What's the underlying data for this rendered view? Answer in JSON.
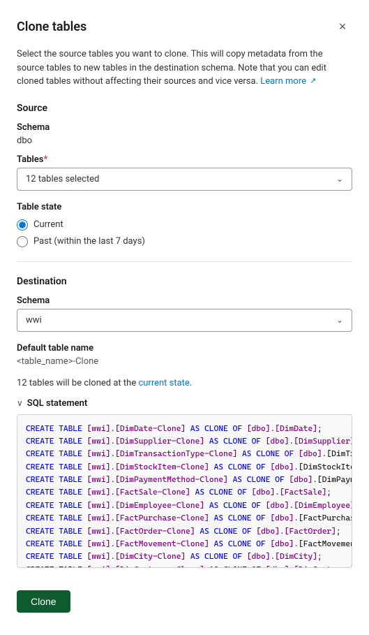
{
  "dialog": {
    "title": "Clone tables",
    "close_label": "×"
  },
  "description": {
    "text": "Select the source tables you want to clone. This will copy metadata from the source tables to new tables in the destination schema. Note that you can edit cloned tables without affecting their sources and vice versa.",
    "learn_more_label": "Learn more",
    "learn_more_icon": "↗"
  },
  "source": {
    "section_label": "Source",
    "schema_label": "Schema",
    "schema_value": "dbo",
    "tables_label": "Tables",
    "tables_required": "*",
    "tables_selected": "12 tables selected",
    "table_state_label": "Table state",
    "radio_current_label": "Current",
    "radio_past_label": "Past (within the last 7 days)"
  },
  "destination": {
    "section_label": "Destination",
    "schema_label": "Schema",
    "schema_value": "wwi",
    "default_name_label": "Default table name",
    "default_name_value": "<table_name>-Clone"
  },
  "clone_info": {
    "text_prefix": "12 tables will be cloned at the ",
    "highlight": "current state",
    "text_suffix": "."
  },
  "sql_statement": {
    "toggle_label": "SQL statement",
    "toggle_icon": "∨",
    "lines": [
      "CREATE TABLE [wwi].[DimDate-Clone] AS CLONE OF [dbo].[DimDate];",
      "CREATE TABLE [wwi].[DimSupplier-Clone] AS CLONE OF [dbo].[DimSupplier];",
      "CREATE TABLE [wwi].[DimTransactionType-Clone] AS CLONE OF [dbo].[DimTra",
      "CREATE TABLE [wwi].[DimStockItem-Clone] AS CLONE OF [dbo].[DimStockItem",
      "CREATE TABLE [wwi].[DimPaymentMethod-Clone] AS CLONE OF [dbo].[DimPayme",
      "CREATE TABLE [wwi].[FactSale-Clone] AS CLONE OF [dbo].[FactSale];",
      "CREATE TABLE [wwi].[DimEmployee-Clone] AS CLONE OF [dbo].[DimEmployee];",
      "CREATE TABLE [wwi].[FactPurchase-Clone] AS CLONE OF [dbo].[FactPurchase",
      "CREATE TABLE [wwi].[FactOrder-Clone] AS CLONE OF [dbo].[FactOrder];",
      "CREATE TABLE [wwi].[FactMovement-Clone] AS CLONE OF [dbo].[FactMovement",
      "CREATE TABLE [wwi].[DimCity-Clone] AS CLONE OF [dbo].[DimCity];",
      "CREATE TABLE [wwi].[DimCustomer-Clone] AS CLONE OF [dbo].[DimCustomer];"
    ]
  },
  "actions": {
    "clone_button_label": "Clone"
  }
}
